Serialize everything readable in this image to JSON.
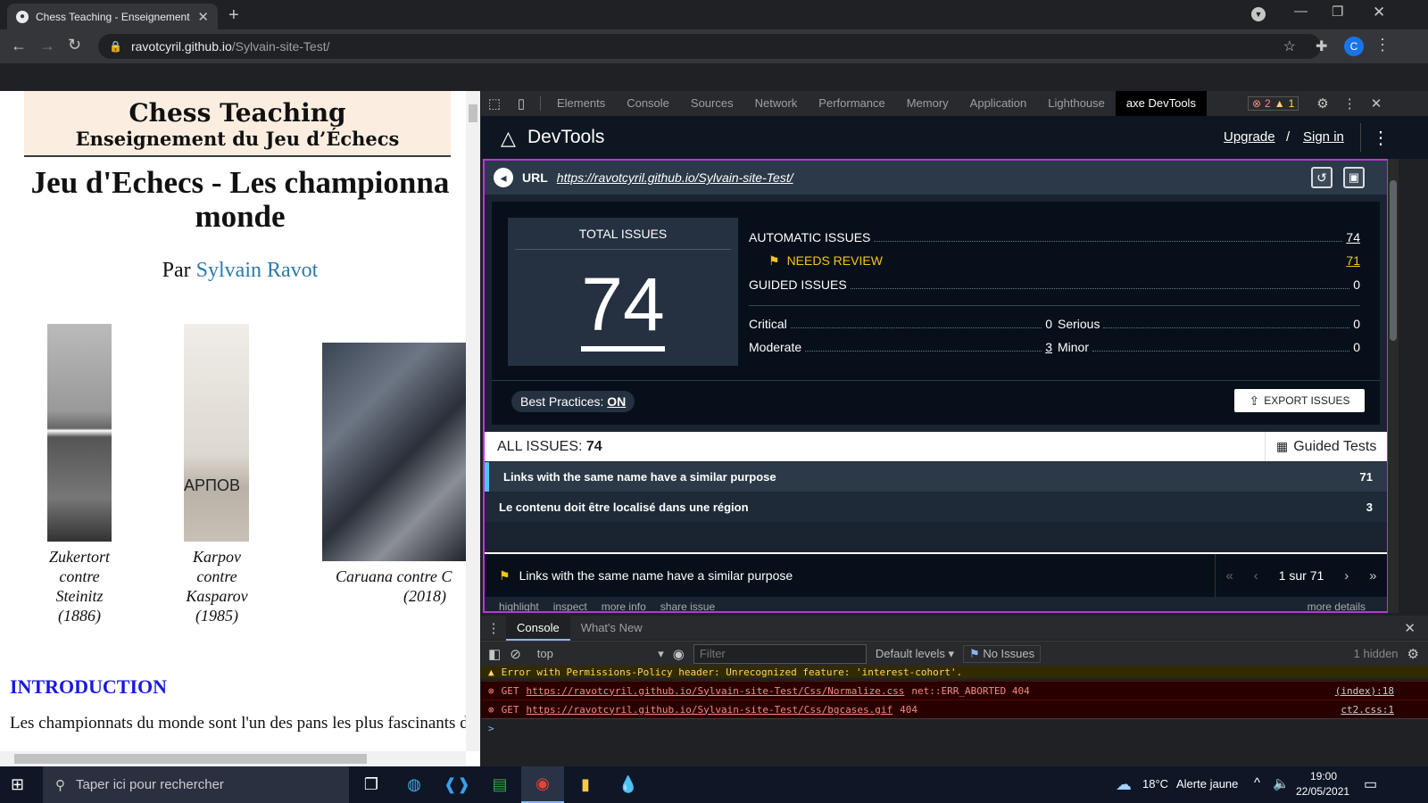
{
  "browser": {
    "tab_title": "Chess Teaching - Enseignement d",
    "url_host": "ravotcyril.github.io",
    "url_path": "/Sylvain-site-Test/",
    "profile_initial": "C"
  },
  "page": {
    "banner_title": "Chess Teaching",
    "banner_subtitle": "Enseignement du Jeu d’Échecs",
    "heading_line1": "Jeu d'Echecs - Les championna",
    "heading_line2": "monde",
    "byline_prefix": "Par",
    "byline_author": "Sylvain Ravot",
    "captions": [
      {
        "l1": "Zukertort",
        "l2": "contre",
        "l3": "Steinitz",
        "l4": "(1886)"
      },
      {
        "l1": "Karpov",
        "l2": "contre",
        "l3": "Kasparov",
        "l4": "(1985)"
      },
      {
        "l1": "Caruana contre C",
        "l2": "(2018)"
      }
    ],
    "image_text": "АРПОВ",
    "intro_heading": "INTRODUCTION",
    "intro_text": "Les championnats du monde sont l'un des pans les plus fascinants d"
  },
  "devtools": {
    "tabs": [
      "Elements",
      "Console",
      "Sources",
      "Network",
      "Performance",
      "Memory",
      "Application",
      "Lighthouse",
      "axe DevTools"
    ],
    "errors_count": "2",
    "warnings_count": "1"
  },
  "axe": {
    "brand": "DevTools",
    "upgrade": "Upgrade",
    "separator": "/",
    "signin": "Sign in",
    "url_label": "URL",
    "url": "https://ravotcyril.github.io/Sylvain-site-Test/",
    "total_label": "TOTAL ISSUES",
    "total": "74",
    "automatic_label": "AUTOMATIC ISSUES",
    "automatic": "74",
    "needs_review_label": "NEEDS REVIEW",
    "needs_review": "71",
    "guided_label": "GUIDED ISSUES",
    "guided": "0",
    "critical_label": "Critical",
    "critical": "0",
    "serious_label": "Serious",
    "serious": "0",
    "moderate_label": "Moderate",
    "moderate": "3",
    "minor_label": "Minor",
    "minor": "0",
    "best_practices_label": "Best Practices:",
    "best_practices_value": "ON",
    "export_label": "EXPORT ISSUES",
    "all_issues_label": "ALL ISSUES:",
    "all_issues_count": "74",
    "guided_tests_label": "Guided Tests",
    "issues": [
      {
        "title": "Links with the same name have a similar purpose",
        "count": "71"
      },
      {
        "title": "Le contenu doit être localisé dans une région",
        "count": "3"
      }
    ],
    "selected_issue": "Links with the same name have a similar purpose",
    "pager": "1 sur 71",
    "sub_links": [
      "highlight",
      "inspect",
      "more info",
      "share issue"
    ],
    "more_details": "more details"
  },
  "console": {
    "tabs": [
      "Console",
      "What's New"
    ],
    "context": "top",
    "filter_placeholder": "Filter",
    "levels": "Default levels",
    "no_issues": "No Issues",
    "hidden": "1 hidden",
    "messages": [
      {
        "type": "warn",
        "text": "Error with Permissions-Policy header: Unrecognized feature: 'interest-cohort'.",
        "source": ""
      },
      {
        "type": "err",
        "method": "GET",
        "url": "https://ravotcyril.github.io/Sylvain-site-Test/Css/Normalize.css",
        "status": "net::ERR_ABORTED 404",
        "source": "(index):18"
      },
      {
        "type": "err",
        "method": "GET",
        "url": "https://ravotcyril.github.io/Sylvain-site-Test/Css/bgcases.gif",
        "status": "404",
        "source": "ct2.css:1"
      }
    ],
    "prompt": ">"
  },
  "taskbar": {
    "search_placeholder": "Taper ici pour rechercher",
    "weather": "18°C",
    "weather_alert": "Alerte jaune",
    "time": "19:00",
    "date": "22/05/2021"
  }
}
